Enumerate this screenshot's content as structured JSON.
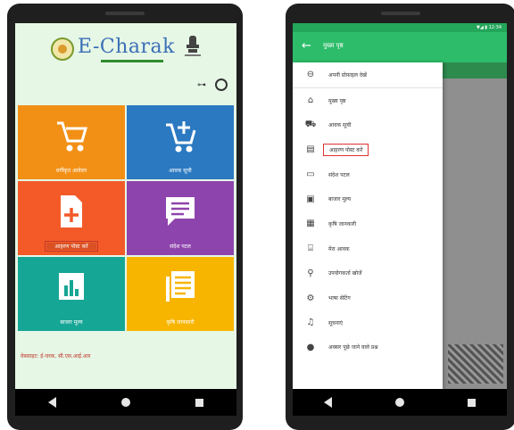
{
  "left_phone": {
    "logo": {
      "text": "E-Charak"
    },
    "toolbar": {
      "key_icon": "key-icon",
      "gear_icon": "gear-icon"
    },
    "tiles": [
      {
        "label": "वर्गीकृत आवेदन",
        "icon": "cart-icon",
        "color": "#f29016"
      },
      {
        "label": "आवक सूची",
        "icon": "cart-add-icon",
        "color": "#2b79c1"
      },
      {
        "label": "आहरण पोस्ट करें",
        "icon": "add-document-icon",
        "color": "#f35a28"
      },
      {
        "label": "संदेश पटल",
        "icon": "chat-icon",
        "color": "#8e44ad"
      },
      {
        "label": "बाजार मूल्य",
        "icon": "bar-chart-icon",
        "color": "#16a696"
      },
      {
        "label": "कृषि जानकारी",
        "icon": "document-list-icon",
        "color": "#f7b500"
      }
    ],
    "footer": "वेबसाइट: ई-चरक, सी.एस.आई.आर"
  },
  "right_phone": {
    "status_text": "▼◢ ▮ 12:34",
    "appbar": {
      "title": "मुख्य पृष्ठ",
      "back_icon": "arrow-left-icon"
    },
    "drawer_items": [
      {
        "label": "अपनी प्रोफ़ाइल देखें",
        "icon": "person-icon"
      },
      {
        "label": "मुख्य पृष्ठ",
        "icon": "home-icon"
      },
      {
        "label": "आवक सूची",
        "icon": "cart-icon"
      },
      {
        "label": "आहरण पोस्ट करें",
        "icon": "document-icon"
      },
      {
        "label": "संदेश पटल",
        "icon": "message-icon"
      },
      {
        "label": "बाजार मूल्य",
        "icon": "price-icon"
      },
      {
        "label": "कृषि जानकारी",
        "icon": "info-icon"
      },
      {
        "label": "मेरा आवक",
        "icon": "inbox-icon"
      },
      {
        "label": "उपयोगकर्ता खोजें",
        "icon": "search-icon"
      },
      {
        "label": "भाषा सेटिंग",
        "icon": "gear-icon"
      },
      {
        "label": "सूचनाएं",
        "icon": "bell-icon"
      },
      {
        "label": "अक्सर पूछे जाने वाले प्रश्न",
        "icon": "help-icon"
      }
    ],
    "selected_index": 3,
    "accent": "#2dbd6a"
  }
}
